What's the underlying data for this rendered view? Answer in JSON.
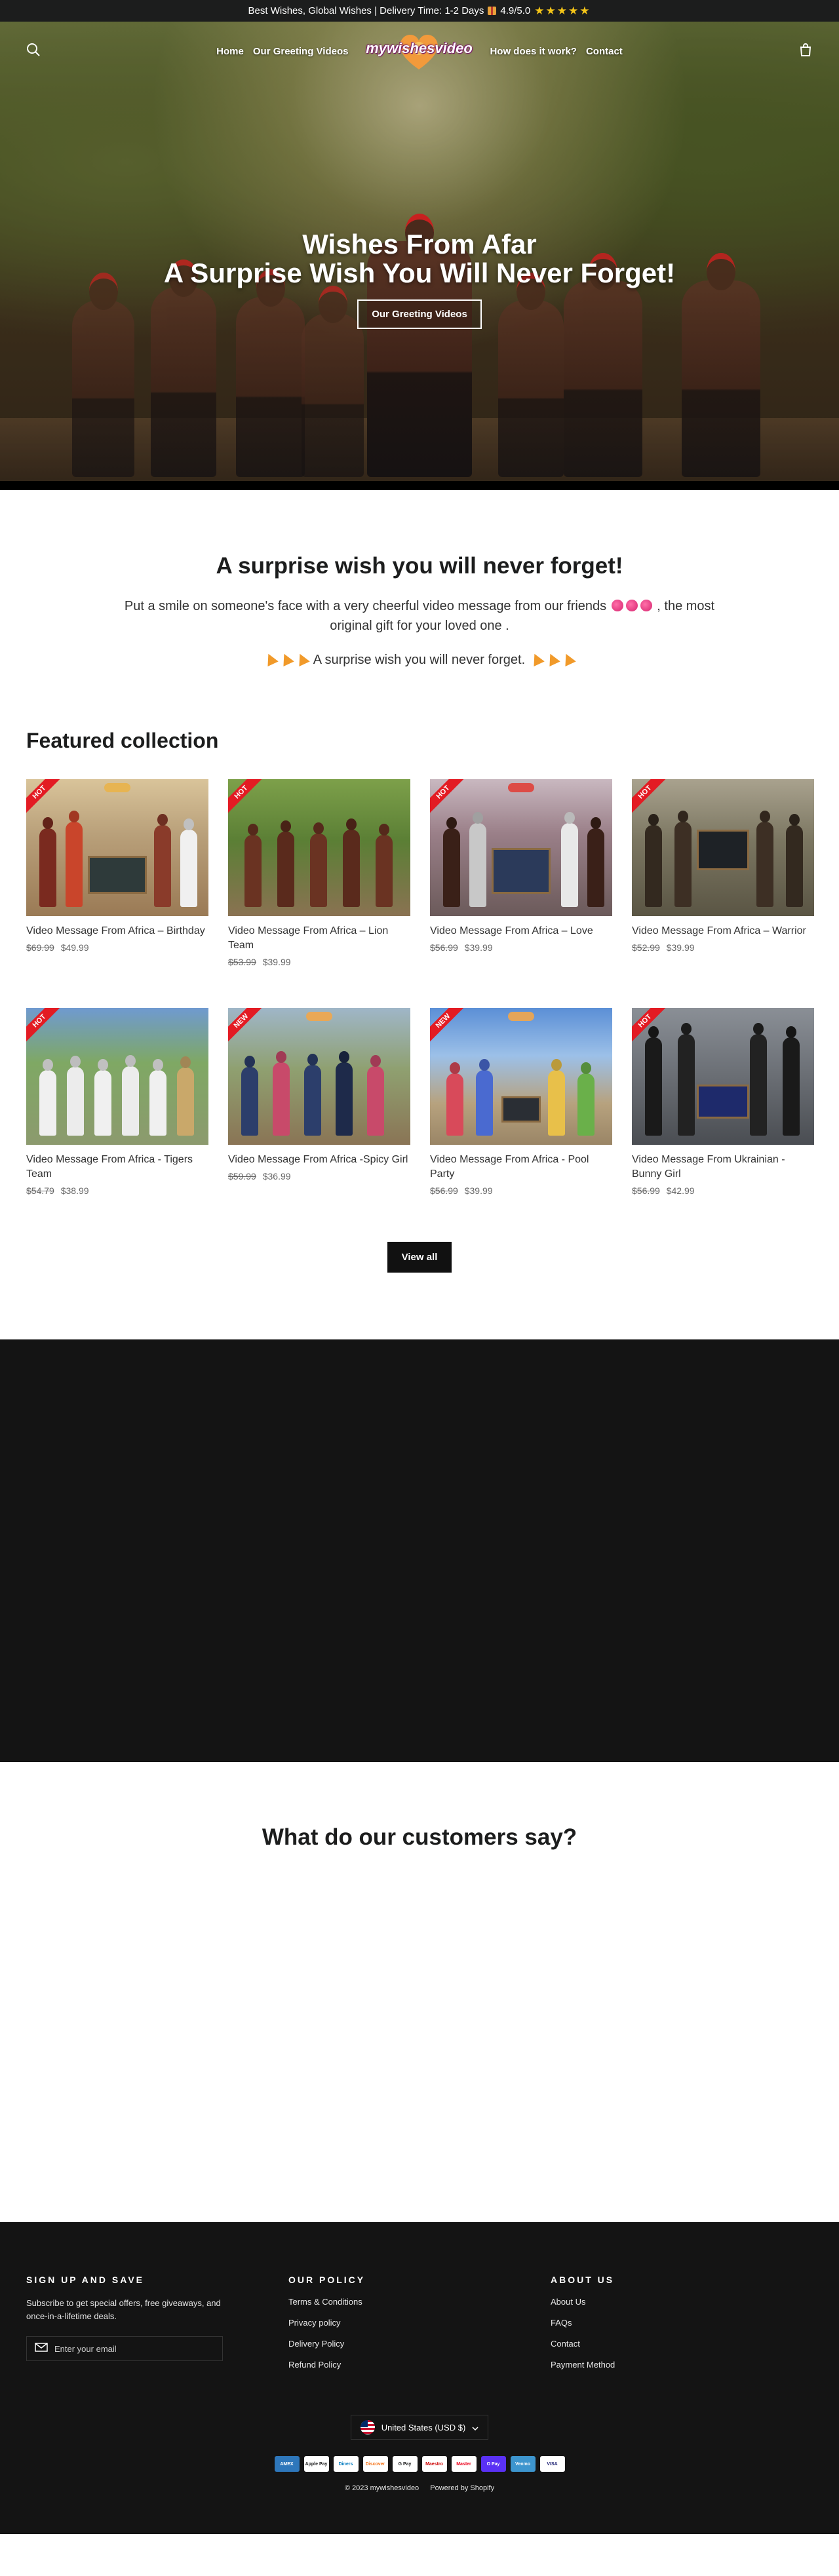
{
  "announcement": {
    "text": "Best Wishes, Global Wishes | Delivery Time: 1-2 Days",
    "rating": "4.9/5.0",
    "stars": "★★★★★"
  },
  "nav": {
    "logo_text": "mywishesvideo",
    "items": [
      "Home",
      "Our Greeting Videos",
      "How does it work?",
      "Contact"
    ]
  },
  "hero": {
    "title_line1": "Wishes From Afar",
    "title_line2": "A Surprise Wish You Will Never Forget!",
    "button": "Our Greeting Videos"
  },
  "intro": {
    "heading": "A surprise wish you will never forget!",
    "paragraph_start": "Put a smile on someone's face with a very cheerful video message from our friends",
    "paragraph_end": ",  the most original gift for your loved one .",
    "tagline": "A surprise wish you will never forget."
  },
  "featured": {
    "heading": "Featured collection",
    "products": [
      {
        "badge": "HOT",
        "title": "Video Message From Africa – Birthday",
        "old_price": "$69.99",
        "price": "$49.99"
      },
      {
        "badge": "HOT",
        "title": "Video Message From Africa – Lion Team",
        "old_price": "$53.99",
        "price": "$39.99"
      },
      {
        "badge": "HOT",
        "title": "Video Message From Africa – Love",
        "old_price": "$56.99",
        "price": "$39.99"
      },
      {
        "badge": "HOT",
        "title": "Video Message From Africa – Warrior",
        "old_price": "$52.99",
        "price": "$39.99"
      },
      {
        "badge": "HOT",
        "title": "Video Message From Africa - Tigers Team",
        "old_price": "$54.79",
        "price": "$38.99"
      },
      {
        "badge": "NEW",
        "title": "Video Message From Africa -Spicy Girl",
        "old_price": "$59.99",
        "price": "$36.99"
      },
      {
        "badge": "NEW",
        "title": "Video Message From Africa - Pool Party",
        "old_price": "$56.99",
        "price": "$39.99"
      },
      {
        "badge": "HOT",
        "title": "Video Message From Ukrainian - Bunny Girl",
        "old_price": "$56.99",
        "price": "$42.99"
      }
    ],
    "view_all": "View all"
  },
  "reviews": {
    "heading": "What do our customers say?"
  },
  "footer": {
    "signup": {
      "heading": "SIGN UP AND SAVE",
      "text": "Subscribe to get special offers, free giveaways, and once-in-a-lifetime deals.",
      "placeholder": "Enter your email"
    },
    "policy": {
      "heading": "OUR POLICY",
      "links": [
        "Terms & Conditions",
        "Privacy policy",
        "Delivery Policy",
        "Refund Policy"
      ]
    },
    "about": {
      "heading": "ABOUT US",
      "links": [
        "About Us",
        "FAQs",
        "Contact",
        "Payment Method"
      ]
    },
    "currency": "United States (USD $)",
    "payments": [
      "AMEX",
      "Apple Pay",
      "Diners",
      "Discover",
      "G Pay",
      "Maestro",
      "Master",
      "O Pay",
      "Venmo",
      "VISA"
    ],
    "copyright": "© 2023 mywishesvideo",
    "powered": "Powered by Shopify"
  },
  "colors": {
    "dark": "#141414",
    "badge_red": "#e31b23",
    "announce_bg": "#1c1d1d"
  }
}
